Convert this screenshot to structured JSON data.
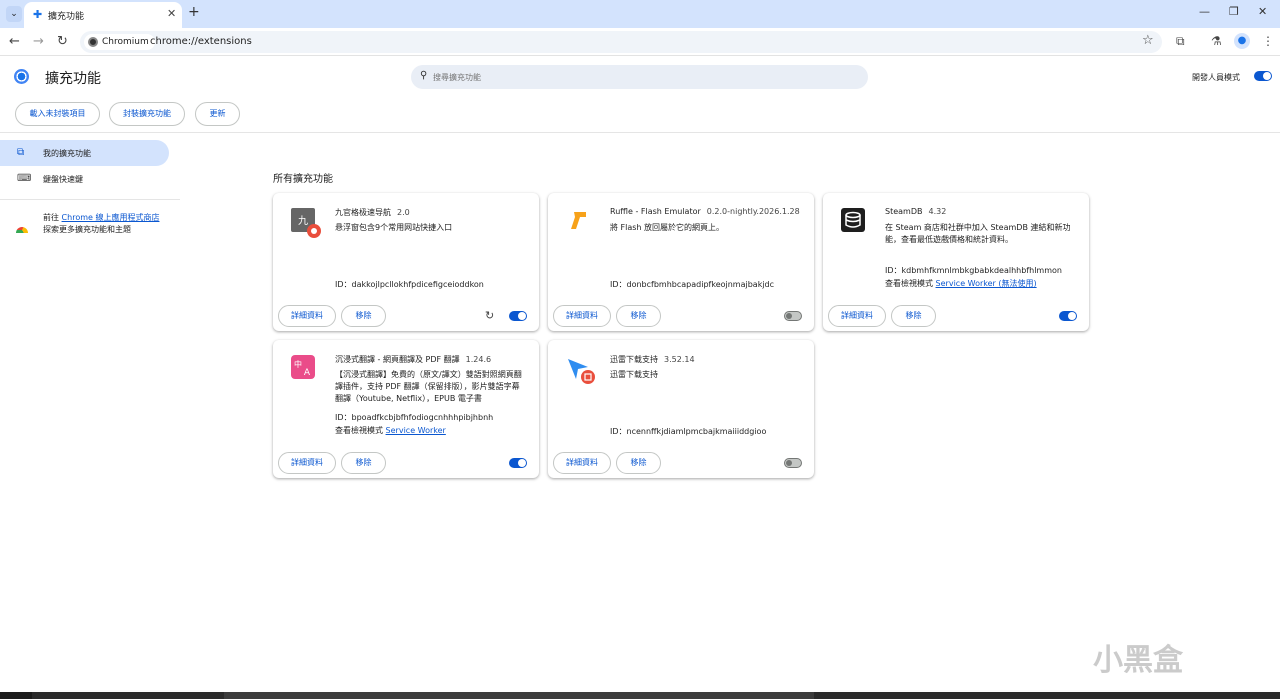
{
  "tab": {
    "title": "擴充功能",
    "close": "✕",
    "new_tab": "+"
  },
  "window": {
    "minimize": "—",
    "restore": "❐",
    "close": "✕"
  },
  "toolbar": {
    "back": "←",
    "forward": "→",
    "reload": "↻",
    "chip_label": "Chromium",
    "url": "chrome://extensions",
    "star": "☆",
    "extensions_icon": "⧉",
    "labs_icon": "⚗",
    "avatar": "●",
    "menu": "⋮"
  },
  "header": {
    "title": "擴充功能",
    "search_placeholder": "搜尋擴充功能",
    "search_icon": "🔍",
    "dev_mode_label": "開發人員模式",
    "dev_mode_on": true,
    "buttons": {
      "load_unpacked": "載入未封裝項目",
      "pack": "封裝擴充功能",
      "update": "更新"
    }
  },
  "sidebar": {
    "items": [
      {
        "icon": "⧉",
        "label": "我的擴充功能"
      },
      {
        "icon": "⌨",
        "label": "鍵盤快速鍵"
      }
    ],
    "store": {
      "prefix": "前往 ",
      "link": "Chrome 線上應用程式商店",
      "suffix": " 探索更多擴充功能和主題"
    }
  },
  "section_title": "所有擴充功能",
  "common": {
    "details": "詳細資料",
    "remove": "移除",
    "reload_icon": "↻"
  },
  "extensions": [
    {
      "name": "九官格极速导航",
      "version": "2.0",
      "desc": "悬浮窗包含9个常用网站快捷入口",
      "id": "ID：dakkojlpcllokhfpdicefigceioddkon",
      "enabled": true,
      "reloadable": true
    },
    {
      "name": "Ruffle - Flash Emulator",
      "version": "0.2.0-nightly.2026.1.28",
      "desc": "將 Flash 放回屬於它的網頁上。",
      "id": "ID：donbcfbmhbcapadipfkeojnmajbakjdc",
      "enabled": false
    },
    {
      "name": "SteamDB",
      "version": "4.32",
      "desc": "在 Steam 商店和社群中加入 SteamDB 連結和新功能，查看最低遊戲價格和統計資料。",
      "id": "ID：kdbmhfkmnlmbkgbabkdealhhbfhlmmon",
      "inspect_prefix": "查看檢視模式 ",
      "inspect_link": "Service Worker (無法使用)",
      "enabled": true
    },
    {
      "name": "沉浸式翻譯 - 網頁翻譯及 PDF 翻譯",
      "version": "1.24.6",
      "desc": "【沉浸式翻譯】免費的（原文/譯文）雙語對照網頁翻譯插件，支持 PDF 翻譯（保留排版），影片雙語字幕翻譯（Youtube, Netflix），EPUB 電子書",
      "id": "ID：bpoadfkcbjbfhfodiogcnhhhpibjhbnh",
      "inspect_prefix": "查看檢視模式 ",
      "inspect_link": "Service Worker",
      "enabled": true
    },
    {
      "name": "迅雷下载支持",
      "version": "3.52.14",
      "desc": "迅雷下载支持",
      "id": "ID：ncennffkjdiamlpmcbajkmaiiiddgioo",
      "enabled": false
    }
  ],
  "watermark": "小黑盒"
}
